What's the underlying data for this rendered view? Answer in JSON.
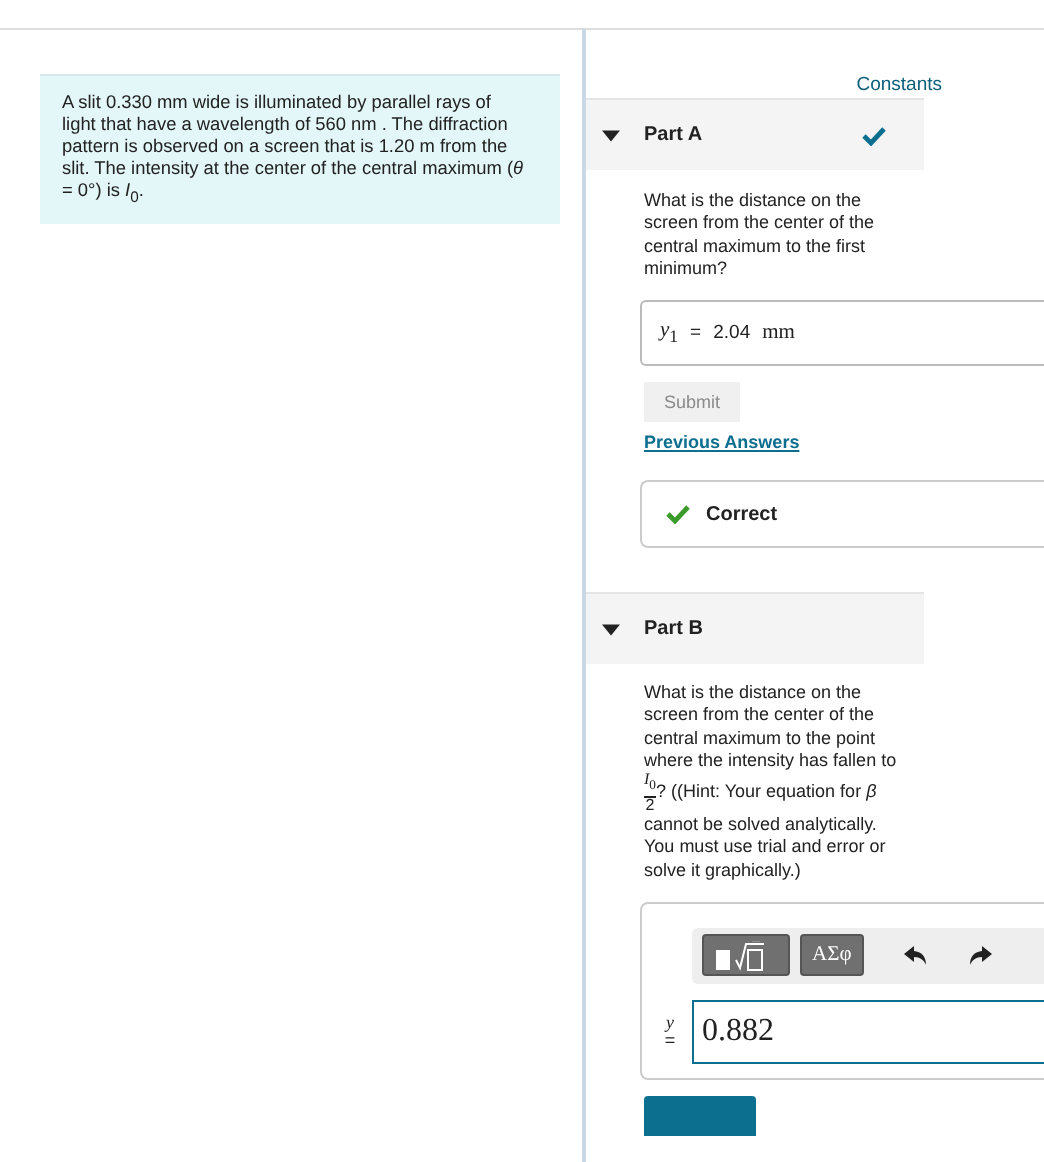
{
  "intro": {
    "text": "A slit 0.330 mm wide is illuminated by parallel rays of light that have a wavelength of 560 nm . The diffraction pattern is observed on a screen that is 1.20 m from the slit. The intensity at the center of the central maximum (*θ* = 0°) is *I*$_{0}$."
  },
  "constants_link": "Constants",
  "parts": [
    {
      "title": "Part A",
      "expanded": true,
      "completed": true,
      "kind": "answered",
      "question": "What is the distance on the screen from the center of the central maximum to the first minimum?",
      "answer": {
        "variable": "*y*$_{1}$",
        "equals": "=",
        "value": "2.04",
        "unit": "mm"
      },
      "submit": {
        "label": "Submit",
        "disabled": true
      },
      "previous_answers": "Previous Answers",
      "feedback": "Correct"
    },
    {
      "title": "Part B",
      "expanded": true,
      "completed": false,
      "kind": "open",
      "question_before": "What is the distance on the screen from the center of the central maximum to the point where the intensity has fallen to",
      "fraction": {
        "numerator": "*I*$_{0}$",
        "denominator": "2"
      },
      "question_after": "? ((Hint: Your equation for *β* cannot be solved analytically. You must use trial and error or solve it graphically.)",
      "toolbar": {
        "symbols_label": "ΑΣφ"
      },
      "answer": {
        "variable": "y",
        "equals": "=",
        "value": "0.882"
      }
    }
  ]
}
